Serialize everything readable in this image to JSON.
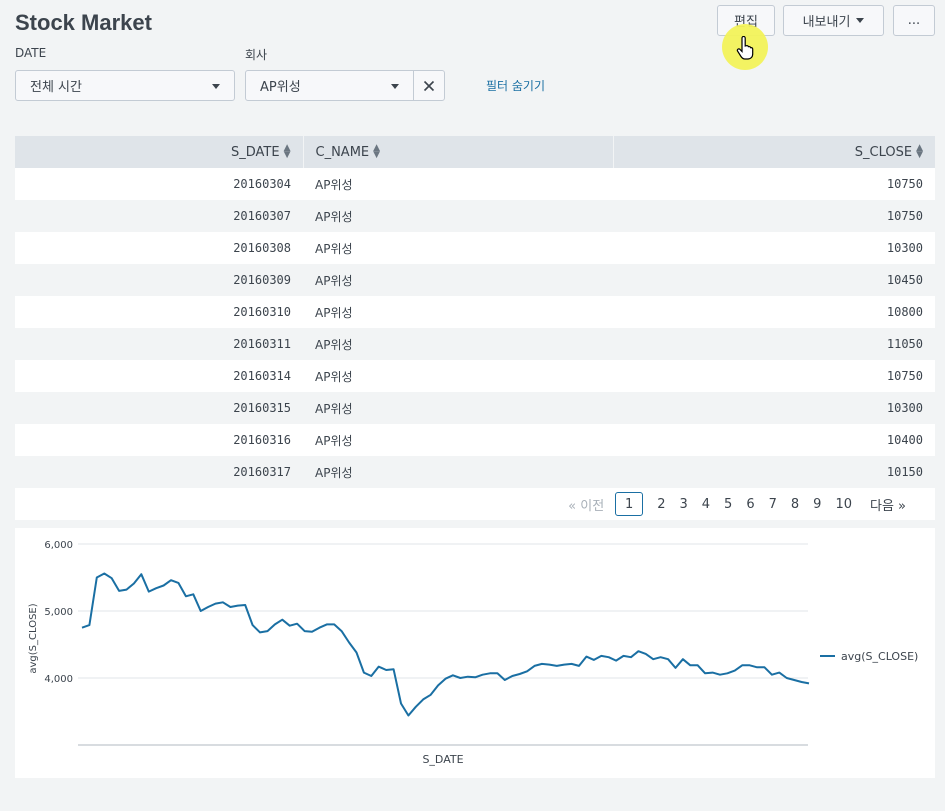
{
  "page": {
    "title": "Stock Market"
  },
  "toolbar": {
    "edit_label": "편집",
    "export_label": "내보내기",
    "more_label": "..."
  },
  "filters": {
    "date": {
      "label": "DATE",
      "value": "전체 시간"
    },
    "company": {
      "label": "회사",
      "value": "AP위성"
    },
    "hide_filters_label": "필터 숨기기"
  },
  "table": {
    "columns": [
      "S_DATE",
      "C_NAME",
      "S_CLOSE"
    ],
    "rows": [
      [
        "20160304",
        "AP위성",
        "10750"
      ],
      [
        "20160307",
        "AP위성",
        "10750"
      ],
      [
        "20160308",
        "AP위성",
        "10300"
      ],
      [
        "20160309",
        "AP위성",
        "10450"
      ],
      [
        "20160310",
        "AP위성",
        "10800"
      ],
      [
        "20160311",
        "AP위성",
        "11050"
      ],
      [
        "20160314",
        "AP위성",
        "10750"
      ],
      [
        "20160315",
        "AP위성",
        "10300"
      ],
      [
        "20160316",
        "AP위성",
        "10400"
      ],
      [
        "20160317",
        "AP위성",
        "10150"
      ]
    ]
  },
  "pagination": {
    "prev_label": "« 이전",
    "pages": [
      "1",
      "2",
      "3",
      "4",
      "5",
      "6",
      "7",
      "8",
      "9",
      "10"
    ],
    "current": "1",
    "next_label": "다음 »"
  },
  "chart_data": {
    "type": "line",
    "xlabel": "S_DATE",
    "ylabel": "avg(S_CLOSE)",
    "ylim": [
      3000,
      6000
    ],
    "yticks": [
      "6,000",
      "5,000",
      "4,000"
    ],
    "ytick_values": [
      6000,
      5000,
      4000
    ],
    "grid": true,
    "legend": "right",
    "color": "#1a6fa3",
    "series": [
      {
        "name": "avg(S_CLOSE)",
        "values": [
          4750,
          4790,
          5500,
          5560,
          5490,
          5300,
          5320,
          5410,
          5550,
          5290,
          5340,
          5380,
          5460,
          5420,
          5220,
          5250,
          5000,
          5060,
          5110,
          5130,
          5060,
          5080,
          5090,
          4790,
          4680,
          4700,
          4800,
          4870,
          4780,
          4810,
          4700,
          4690,
          4750,
          4800,
          4800,
          4700,
          4530,
          4380,
          4080,
          4030,
          4170,
          4120,
          4130,
          3620,
          3440,
          3570,
          3680,
          3750,
          3890,
          3990,
          4040,
          4000,
          4020,
          4010,
          4050,
          4070,
          4070,
          3970,
          4030,
          4060,
          4100,
          4180,
          4210,
          4200,
          4180,
          4200,
          4210,
          4180,
          4320,
          4270,
          4330,
          4310,
          4260,
          4330,
          4310,
          4400,
          4360,
          4280,
          4310,
          4280,
          4150,
          4280,
          4190,
          4190,
          4070,
          4080,
          4050,
          4070,
          4110,
          4190,
          4190,
          4160,
          4160,
          4050,
          4080,
          4000,
          3970,
          3940,
          3920
        ]
      }
    ]
  }
}
